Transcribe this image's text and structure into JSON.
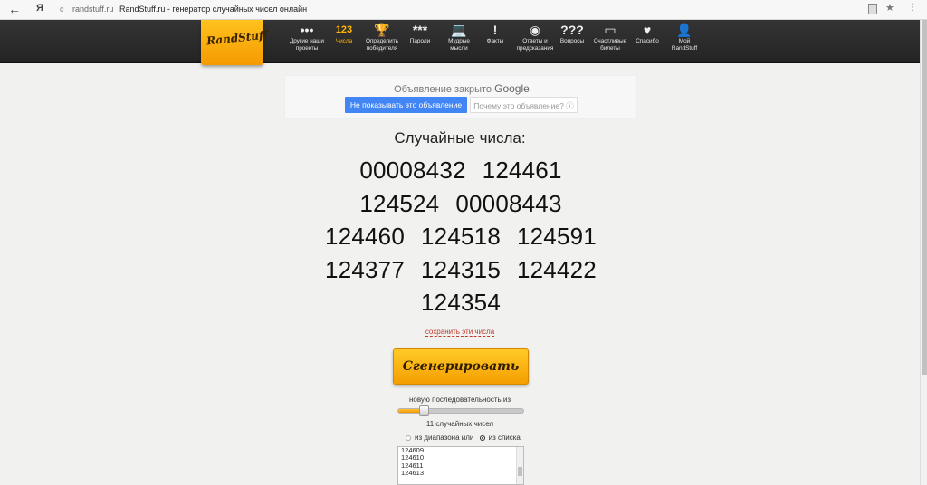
{
  "browser": {
    "back_icon": "←",
    "logo": "Я",
    "domain": "randstuff.ru",
    "title": "RandStuff.ru - генератор случайных чисел онлайн",
    "star_icon": "★",
    "menu_icon": "⋮"
  },
  "header": {
    "logo": "RandStuff",
    "nav": [
      {
        "icon": "•••",
        "label": "Другие наши проекты"
      },
      {
        "icon": "123",
        "label": "Числа"
      },
      {
        "icon": "🏆",
        "label": "Определить победителя"
      },
      {
        "icon": "***",
        "label": "Пароли"
      },
      {
        "icon": "💻",
        "label": "Мудрые мысли"
      },
      {
        "icon": "!",
        "label": "Факты"
      },
      {
        "icon": "◉",
        "label": "Ответы и предсказания"
      },
      {
        "icon": "???",
        "label": "Вопросы"
      },
      {
        "icon": "▭",
        "label": "Счастливые билеты"
      },
      {
        "icon": "♥",
        "label": "Спасибо"
      },
      {
        "icon": "👤",
        "label": "Мой RandStuff"
      }
    ]
  },
  "ad": {
    "closed_text": "Объявление закрыто",
    "brand": "Google",
    "dont_show": "Не показывать это объявление",
    "why": "Почему это объявление? ⓘ"
  },
  "main": {
    "heading": "Случайные числа:",
    "numbers": [
      "00008432",
      "124461",
      "124524",
      "00008443",
      "124460",
      "124518",
      "124591",
      "124377",
      "124315",
      "124422",
      "124354"
    ],
    "save_link": "сохранить эти числа",
    "generate_button": "Сгенерировать",
    "sequence_label": "новую последовательность из",
    "slider_fraction": 0.2,
    "count_label": "11 случайных чисел",
    "radio_range": "из диапазона или",
    "radio_list": "из списка",
    "list_values": [
      "124609",
      "124610",
      "124611",
      "124613"
    ]
  }
}
